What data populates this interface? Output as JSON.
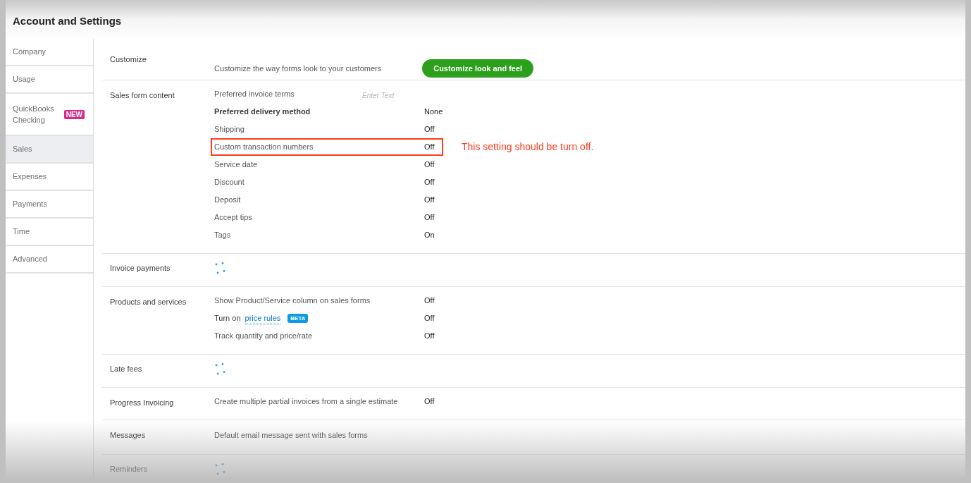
{
  "title": "Account and Settings",
  "sidebar": {
    "items": [
      {
        "label": "Company",
        "selected": false
      },
      {
        "label": "Usage",
        "selected": false
      },
      {
        "label": "QuickBooks Checking",
        "badge": "NEW",
        "selected": false
      },
      {
        "label": "Sales",
        "selected": true
      },
      {
        "label": "Expenses",
        "selected": false
      },
      {
        "label": "Payments",
        "selected": false
      },
      {
        "label": "Time",
        "selected": false
      },
      {
        "label": "Advanced",
        "selected": false
      }
    ]
  },
  "sections": [
    {
      "kind": "button",
      "label": "Customize",
      "description": "Customize the way forms look to your customers",
      "button": "Customize look and feel"
    },
    {
      "kind": "settings",
      "label": "Sales form content",
      "items": [
        {
          "kind": "input",
          "label": "Preferred invoice terms",
          "placeholder": "Enter Text"
        },
        {
          "kind": "toggle",
          "label": "Preferred delivery method",
          "value": "None",
          "bold": true,
          "highlighted": false
        },
        {
          "kind": "toggle",
          "label": "Shipping",
          "value": "Off",
          "bold": false,
          "highlighted": false
        },
        {
          "kind": "toggle",
          "label": "Custom transaction numbers",
          "value": "Off",
          "bold": false,
          "highlighted": true,
          "note": "This setting should be turn off."
        },
        {
          "kind": "toggle",
          "label": "Service date",
          "value": "Off",
          "bold": false,
          "highlighted": false
        },
        {
          "kind": "toggle",
          "label": "Discount",
          "value": "Off",
          "bold": false,
          "highlighted": false
        },
        {
          "kind": "toggle",
          "label": "Deposit",
          "value": "Off",
          "bold": false,
          "highlighted": false
        },
        {
          "kind": "toggle",
          "label": "Accept tips",
          "value": "Off",
          "bold": false,
          "highlighted": false
        },
        {
          "kind": "toggle",
          "label": "Tags",
          "value": "On",
          "bold": false,
          "highlighted": false
        }
      ]
    },
    {
      "kind": "loading",
      "label": "Invoice payments"
    },
    {
      "kind": "settings",
      "label": "Products and services",
      "items": [
        {
          "kind": "toggle",
          "label": "Show Product/Service column on sales forms",
          "value": "Off",
          "bold": false,
          "highlighted": false
        },
        {
          "kind": "link",
          "prefix": "Turn on",
          "link": "price rules",
          "badge": "BETA",
          "value": "Off"
        },
        {
          "kind": "toggle",
          "label": "Track quantity and price/rate",
          "value": "Off",
          "bold": false,
          "highlighted": false
        }
      ]
    },
    {
      "kind": "loading",
      "label": "Late fees"
    },
    {
      "kind": "settings",
      "label": "Progress Invoicing",
      "items": [
        {
          "kind": "toggle",
          "label": "Create multiple partial invoices from a single estimate",
          "value": "Off",
          "bold": false,
          "highlighted": false
        }
      ]
    },
    {
      "kind": "text",
      "label": "Messages",
      "description": "Default email message sent with sales forms"
    },
    {
      "kind": "loading",
      "label": "Reminders"
    }
  ]
}
